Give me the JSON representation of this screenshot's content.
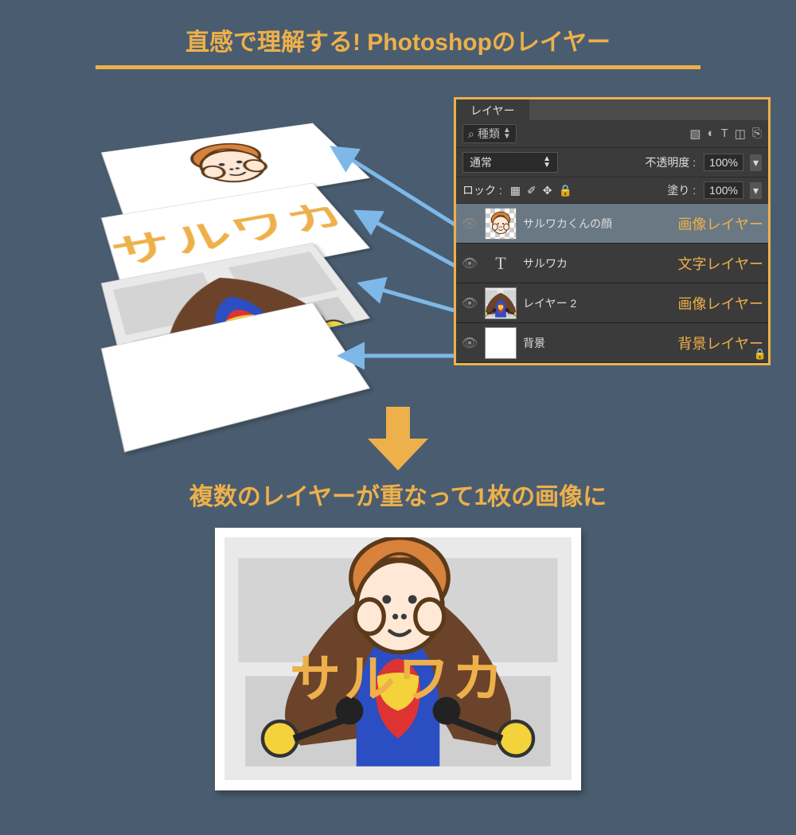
{
  "colors": {
    "bg": "#4a5d70",
    "accent": "#eeb04a",
    "panel_bg": "#3b3b3b"
  },
  "title": "直感で理解する! Photoshopのレイヤー",
  "stack_layers": {
    "face_alt": "サルワカくんの顔イラスト",
    "text_content": "サルワカ",
    "photo_alt": "ジムの人物写真",
    "bg_alt": "白背景"
  },
  "panel": {
    "tab_label": "レイヤー",
    "search_label": "種類",
    "blend_mode": "通常",
    "opacity_label": "不透明度 :",
    "opacity_value": "100%",
    "lock_label": "ロック :",
    "fill_label": "塗り :",
    "fill_value": "100%",
    "tool_icons": [
      "image-icon",
      "adjustment-icon",
      "type-icon",
      "shape-icon",
      "smartobject-icon"
    ],
    "lock_icons": [
      "checker-icon",
      "brush-icon",
      "move-icon",
      "lock-icon"
    ],
    "items": [
      {
        "name": "サルワカくんの顔",
        "tag": "画像レイヤー",
        "thumb": "face",
        "selected": true
      },
      {
        "name": "サルワカ",
        "tag": "文字レイヤー",
        "thumb": "text",
        "selected": false
      },
      {
        "name": "レイヤー 2",
        "tag": "画像レイヤー",
        "thumb": "photo",
        "selected": false
      },
      {
        "name": "背景",
        "tag": "背景レイヤー",
        "thumb": "white",
        "selected": false,
        "locked": true
      }
    ]
  },
  "subtitle": "複数のレイヤーが重なって1枚の画像に",
  "composite_text": "サルワカ"
}
